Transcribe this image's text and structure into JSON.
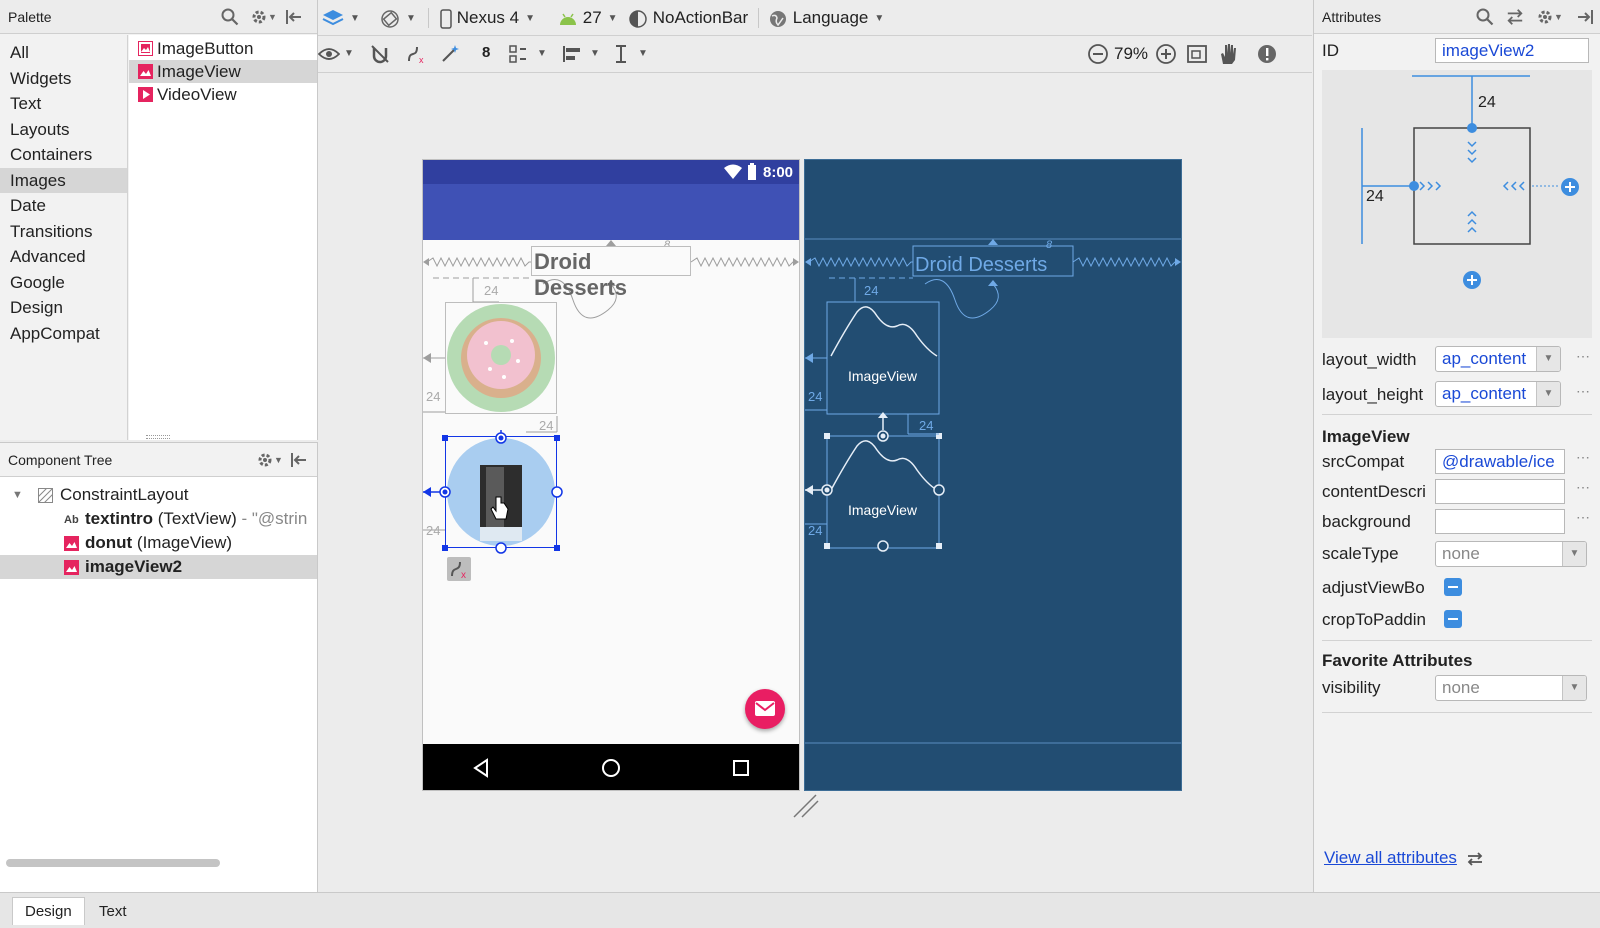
{
  "palette": {
    "title": "Palette",
    "categories": [
      "All",
      "Widgets",
      "Text",
      "Layouts",
      "Containers",
      "Images",
      "Date",
      "Transitions",
      "Advanced",
      "Google",
      "Design",
      "AppCompat"
    ],
    "selected_category": "Images",
    "items": [
      {
        "label": "ImageButton",
        "icon": "image-button-icon"
      },
      {
        "label": "ImageView",
        "icon": "image-view-icon"
      },
      {
        "label": "VideoView",
        "icon": "video-view-icon"
      }
    ],
    "selected_item": "ImageView"
  },
  "component_tree": {
    "title": "Component Tree",
    "rows": [
      {
        "bold": "ConstraintLayout",
        "rest": "",
        "icon": "constraint-layout-icon"
      },
      {
        "bold": "textintro",
        "rest": " (TextView)",
        "hint": " - \"@strin",
        "icon": "text-view-icon"
      },
      {
        "bold": "donut",
        "rest": " (ImageView)",
        "icon": "image-view-icon"
      },
      {
        "bold": "imageView2",
        "rest": "",
        "icon": "image-view-icon"
      }
    ]
  },
  "toolbar": {
    "device": "Nexus 4",
    "api": "27",
    "theme": "NoActionBar",
    "language": "Language",
    "default_margin": "8",
    "zoom": "79%"
  },
  "design_preview": {
    "status_time": "8:00",
    "title_text": "Droid Desserts",
    "margin_label": "24",
    "small_label": "8"
  },
  "blueprint": {
    "title_text": "Droid Desserts",
    "imageview_label": "ImageView",
    "margin_label": "24",
    "small_label": "8"
  },
  "attributes": {
    "title": "Attributes",
    "id_label": "ID",
    "id_value": "imageView2",
    "constraint_top": "24",
    "constraint_left": "24",
    "layout_width_label": "layout_width",
    "layout_width_value": "ap_content",
    "layout_height_label": "layout_height",
    "layout_height_value": "ap_content",
    "section_imageview": "ImageView",
    "src_label": "srcCompat",
    "src_value": "@drawable/ice",
    "content_label": "contentDescri",
    "content_value": "",
    "background_label": "background",
    "background_value": "",
    "scaletype_label": "scaleType",
    "scaletype_value": "none",
    "adjust_label": "adjustViewBo",
    "crop_label": "cropToPaddin",
    "section_fav": "Favorite Attributes",
    "visibility_label": "visibility",
    "visibility_value": "none",
    "view_all": "View all attributes"
  },
  "bottom_tabs": [
    "Design",
    "Text"
  ],
  "colors": {
    "accent_blue": "#1a49d6",
    "app_bar": "#3f51b5",
    "status_bar": "#303f9f",
    "blueprint_bg": "#224d72",
    "fab": "#e91e63",
    "selection": "#1236e6"
  }
}
